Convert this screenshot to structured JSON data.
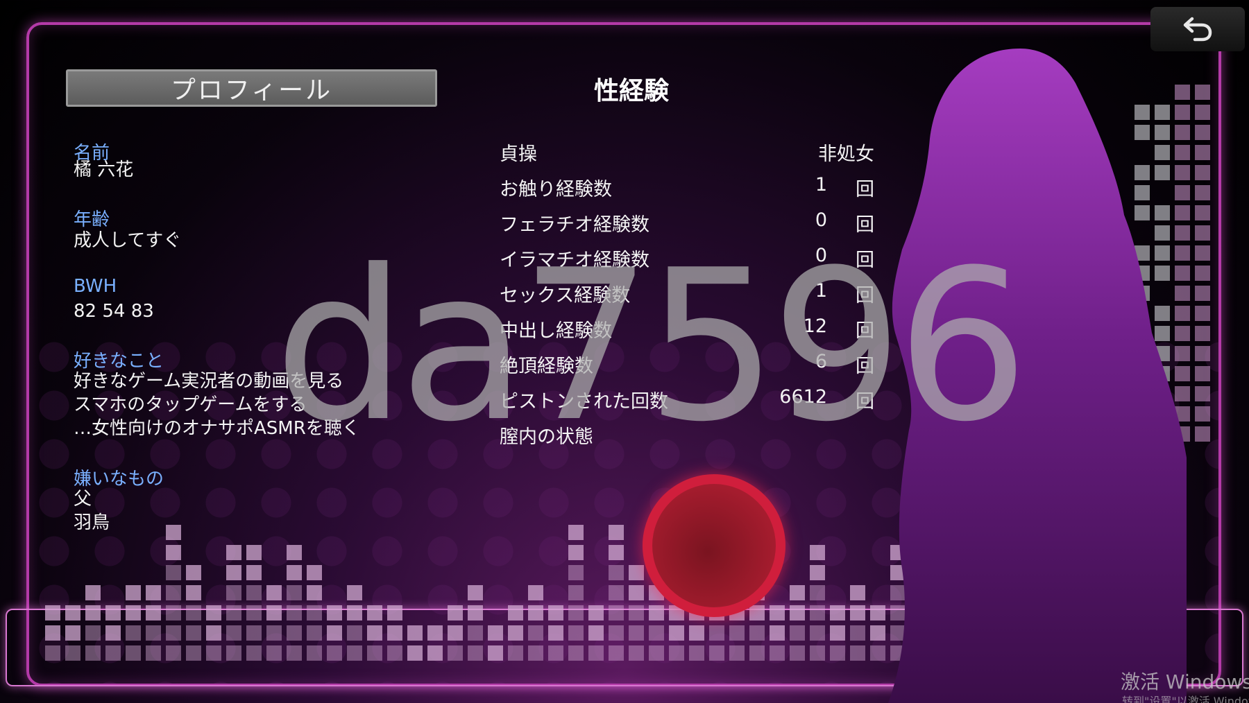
{
  "profile": {
    "header": "プロフィール",
    "name_label": "名前",
    "name_value": "橘 六花",
    "age_label": "年齢",
    "age_value": "成人してすぐ",
    "bwh_label": "BWH",
    "bwh_value": "82 54 83",
    "likes_label": "好きなこと",
    "likes": [
      "好きなゲーム実況者の動画を見る",
      "スマホのタップゲームをする",
      "…女性向けのオナサポASMRを聴く"
    ],
    "dislikes_label": "嫌いなもの",
    "dislikes": [
      "父",
      "羽鳥"
    ]
  },
  "experience": {
    "title": "性経験",
    "rows": [
      {
        "label": "貞操",
        "value": "非処女",
        "unit": ""
      },
      {
        "label": "お触り経験数",
        "value": "1",
        "unit": "回"
      },
      {
        "label": "フェラチオ経験数",
        "value": "0",
        "unit": "回"
      },
      {
        "label": "イラマチオ経験数",
        "value": "0",
        "unit": "回"
      },
      {
        "label": "セックス経験数",
        "value": "1",
        "unit": "回"
      },
      {
        "label": "中出し経験数",
        "value": "12",
        "unit": "回"
      },
      {
        "label": "絶頂経験数",
        "value": "6",
        "unit": "回"
      },
      {
        "label": "ピストンされた回数",
        "value": "6612",
        "unit": "回"
      },
      {
        "label": "膣内の状態",
        "value": "",
        "unit": ""
      }
    ]
  },
  "watermark": "da7596",
  "windows_activation": {
    "title": "激活 Windows",
    "subtitle": "转到\"设置\"以激活 Windows。"
  },
  "icons": {
    "back": "back-arrow-icon",
    "record": "record-button-icon"
  },
  "colors": {
    "frame": "#b43aa8",
    "label_blue": "#7ab0ff",
    "record_red": "#d01e3c",
    "silhouette_top": "#9a33b0"
  }
}
